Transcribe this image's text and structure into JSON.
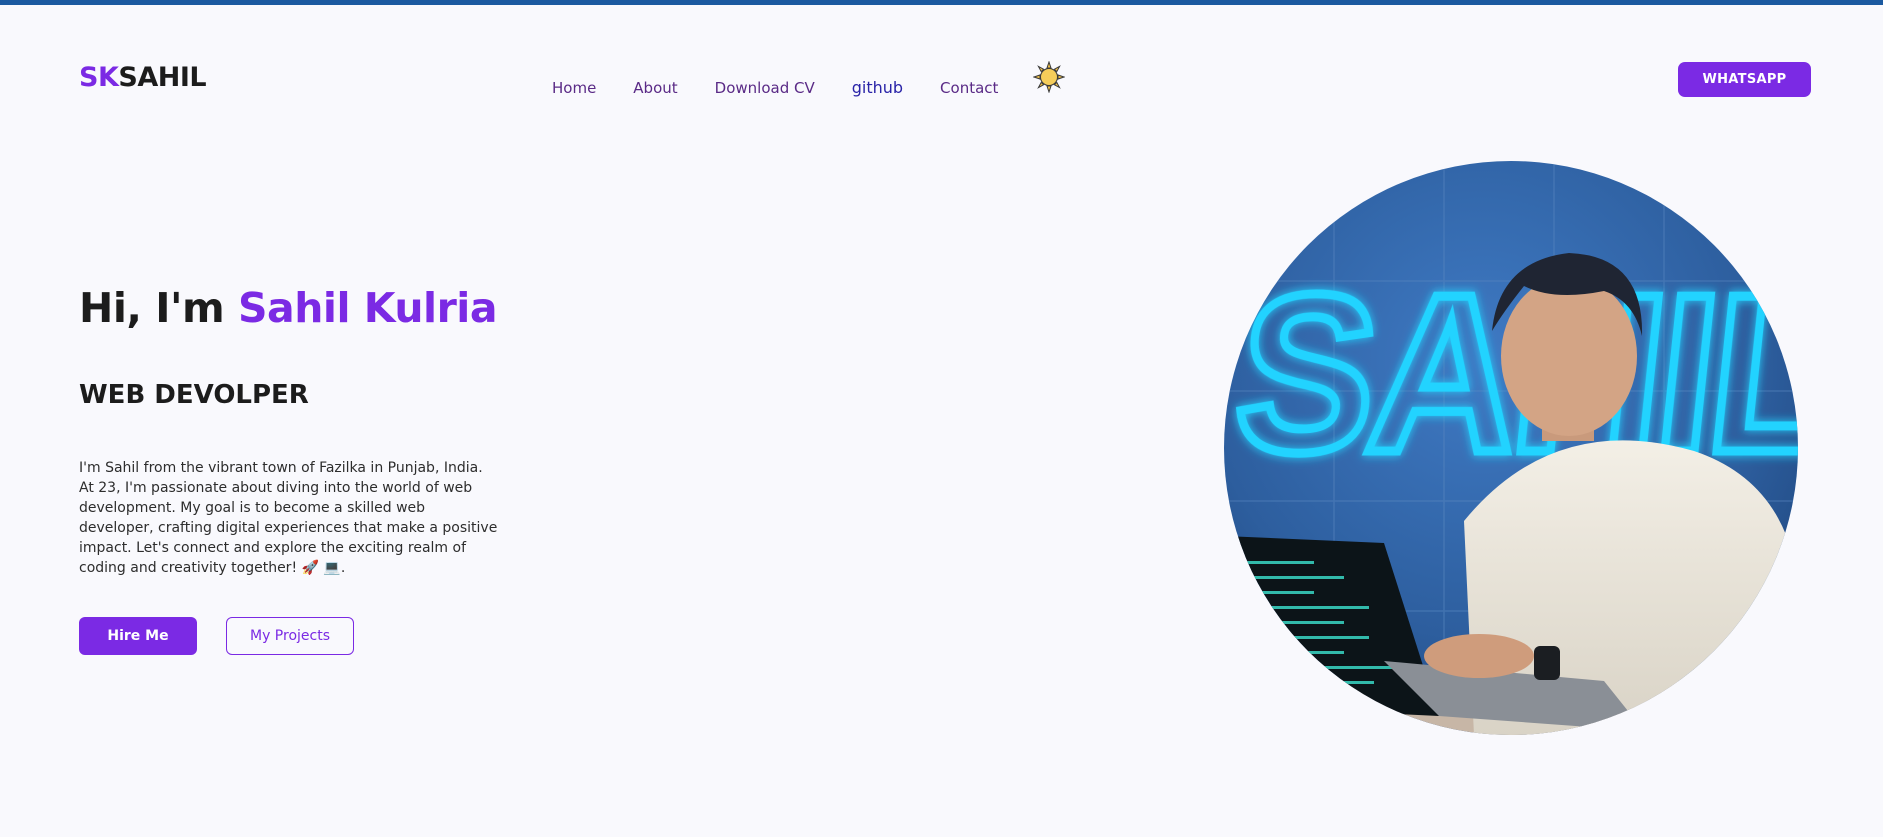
{
  "logo": {
    "prefix": "SK",
    "rest": "SAHIL"
  },
  "nav": {
    "items": [
      {
        "label": "Home"
      },
      {
        "label": "About"
      },
      {
        "label": "Download CV"
      },
      {
        "label": "github"
      },
      {
        "label": "Contact"
      }
    ],
    "theme_icon": "sun-icon"
  },
  "header": {
    "whatsapp_label": "WHATSAPP"
  },
  "hero": {
    "greeting": "Hi, I'm",
    "name": "Sahil Kulria",
    "role": "WEB DEVOLPER",
    "bio": "I'm Sahil from the vibrant town of Fazilka in Punjab, India. At 23, I'm passionate about diving into the world of web development. My goal is to become a skilled web developer, crafting digital experiences that make a positive impact. Let's connect and explore the exciting realm of coding and creativity together! 🚀 💻.",
    "hire_label": "Hire Me",
    "projects_label": "My Projects"
  },
  "portrait": {
    "neon_text": "SAHIL"
  },
  "colors": {
    "accent": "#7b2ae4",
    "top_bar": "#1b5aa0",
    "nav_link": "#5a2a86",
    "background": "#f9f9fd",
    "neon": "#22d3ff"
  }
}
